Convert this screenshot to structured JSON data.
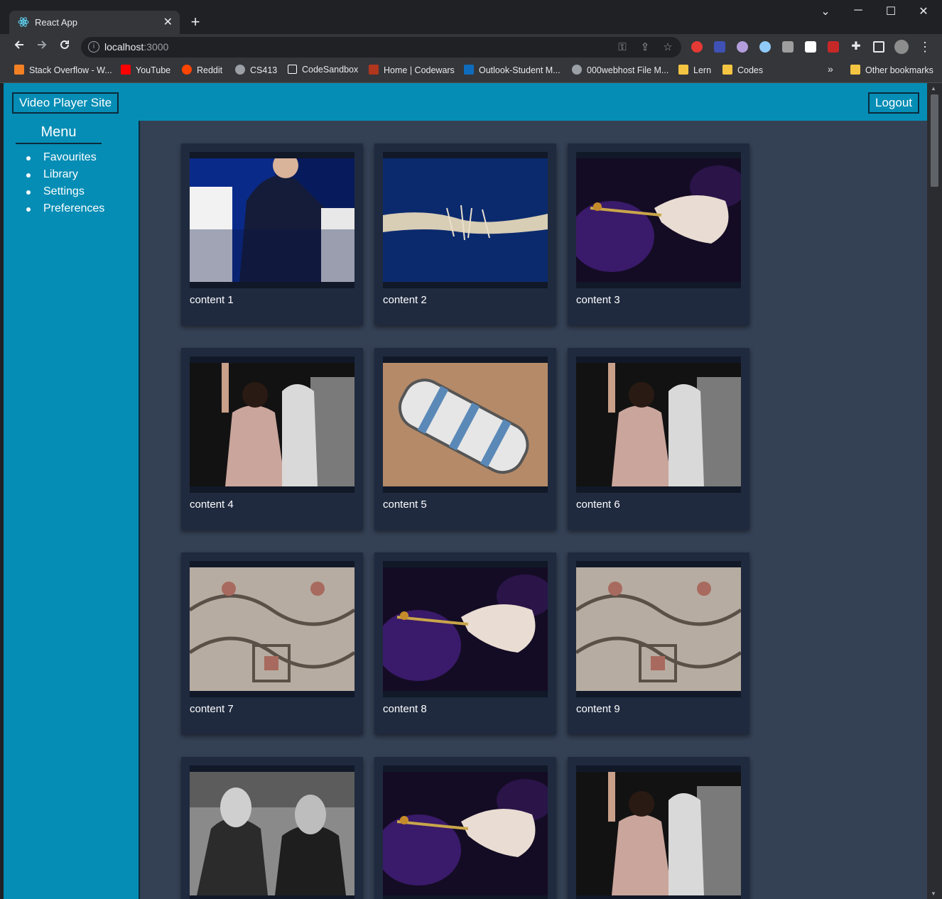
{
  "browser": {
    "tab_title": "React App",
    "tab_close": "✕",
    "new_tab": "+",
    "win_min": "─",
    "win_max": "☐",
    "win_close": "✕",
    "win_dropdown": "⌄",
    "url_host": "localhost",
    "url_port": ":3000",
    "info_icon": "i",
    "bookmarks": [
      {
        "label": "Stack Overflow - W...",
        "icon_color": "#f48024"
      },
      {
        "label": "YouTube",
        "icon_color": "#ff0000"
      },
      {
        "label": "Reddit",
        "icon_color": "#ff4500"
      },
      {
        "label": "CS413",
        "icon_color": "#9aa0a6"
      },
      {
        "label": "CodeSandbox",
        "icon_color": "#ffffff"
      },
      {
        "label": "Home | Codewars",
        "icon_color": "#b1361e"
      },
      {
        "label": "Outlook-Student M...",
        "icon_color": "#0f6cbd"
      },
      {
        "label": "000webhost File M...",
        "icon_color": "#9aa0a6"
      },
      {
        "label": "Lern",
        "icon_color": "#f4c542"
      },
      {
        "label": "Codes",
        "icon_color": "#f4c542"
      }
    ],
    "more_bookmarks": "»",
    "other_bookmarks": "Other bookmarks"
  },
  "header": {
    "brand": "Video Player Site",
    "logout": "Logout"
  },
  "sidebar": {
    "title": "Menu",
    "items": [
      {
        "label": "Favourites"
      },
      {
        "label": "Library"
      },
      {
        "label": "Settings"
      },
      {
        "label": "Preferences"
      }
    ]
  },
  "cards": [
    {
      "label": "content 1",
      "image": "speaker-on-stage"
    },
    {
      "label": "content 2",
      "image": "fraying-rope"
    },
    {
      "label": "content 3",
      "image": "hibiscus-flower"
    },
    {
      "label": "content 4",
      "image": "dancing-crowd"
    },
    {
      "label": "content 5",
      "image": "battery-pack"
    },
    {
      "label": "content 6",
      "image": "dancing-crowd"
    },
    {
      "label": "content 7",
      "image": "mosaic-floor"
    },
    {
      "label": "content 8",
      "image": "hibiscus-flower"
    },
    {
      "label": "content 9",
      "image": "mosaic-floor"
    },
    {
      "label": "",
      "image": "men-talking-bw"
    },
    {
      "label": "",
      "image": "hibiscus-flower"
    },
    {
      "label": "",
      "image": "dancing-crowd"
    }
  ]
}
